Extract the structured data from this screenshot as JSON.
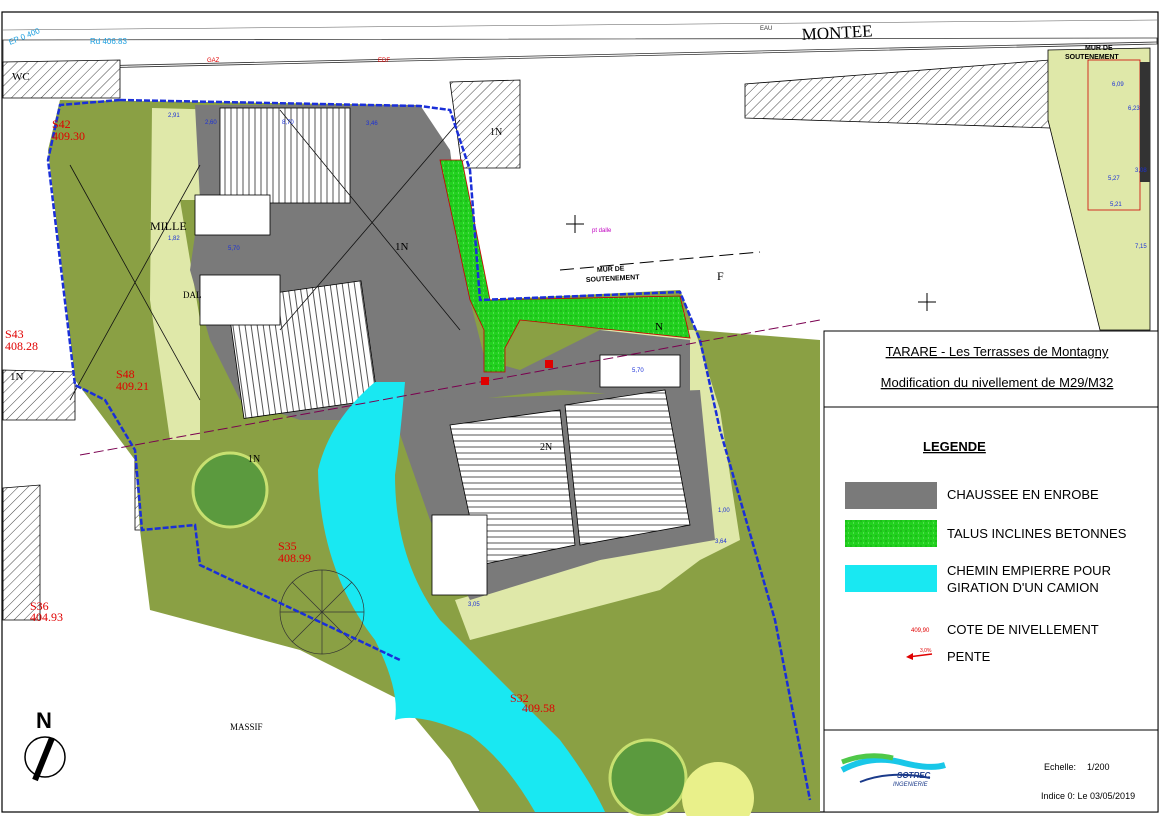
{
  "title_block": {
    "project": "TARARE - Les Terrasses de Montagny",
    "subject": "Modification du nivellement de M29/M32"
  },
  "legend": {
    "title": "LEGENDE",
    "items": [
      {
        "label": "CHAUSSEE EN ENROBE",
        "color": "#7a7a7a"
      },
      {
        "label": "TALUS INCLINES BETONNES",
        "color": "#22d11f"
      },
      {
        "label_line1": "CHEMIN EMPIERRE POUR",
        "label_line2": "GIRATION D'UN CAMION",
        "color": "#19e8f2"
      },
      {
        "sample": "409,90",
        "label": "COTE DE NIVELLEMENT",
        "color": "#e00000"
      },
      {
        "sample": "3,0%",
        "label": "PENTE",
        "color": "#e00000"
      }
    ]
  },
  "company": {
    "name": "SOTREC",
    "sub": "INGENIERIE"
  },
  "scale": {
    "label": "Echelle:",
    "value": "1/200"
  },
  "revision": "Indice 0: Le 03/05/2019",
  "north": "N",
  "colors": {
    "lawn": "#8aa044",
    "pale_green": "#dfe8a9",
    "paving": "#7a7a7a",
    "talus": "#22d11f",
    "path": "#19e8f2",
    "boundary": "#1a2fd8",
    "level": "#e00000"
  },
  "map_labels": {
    "road": "MONTEE",
    "wall": "MUR DE",
    "wall2": "SOUTENEMENT",
    "wall_right": "MUR DE",
    "wall_right2": "SOUTENEMENT",
    "mille": "MILLE",
    "massif": "MASSIF",
    "wc": "WC",
    "gaz": "GAZ",
    "edf": "EDF",
    "eau": "EAU",
    "pt_dalle": "pt dalle",
    "ep": "EP 0 400",
    "rd": "Rd 406.83",
    "dal": "DAL",
    "n1a": "1N",
    "n1b": "1N",
    "n1c": "1N",
    "n1d": "1N",
    "n2": "2N",
    "n3": "N",
    "f1": "F",
    "s42": "S42",
    "s42v": "409.30",
    "s43": "S43",
    "s43v": "408.28",
    "s48": "S48",
    "s48v": "409.21",
    "s35": "S35",
    "s35v": "408.99",
    "s36": "S36",
    "s36v": "404.93",
    "s32": "S32",
    "s32v": "409.58",
    "dim_291": "2,91",
    "dim_260": "2,60",
    "dim_870": "8,70",
    "dim_346": "3,46",
    "dim_570a": "5,70",
    "dim_570b": "5,70",
    "dim_609": "6,09",
    "dim_623": "6,23",
    "dim_527": "5,27",
    "dim_521": "5,21",
    "dim_715": "7,15",
    "dim_308": "3,08",
    "dim_364": "3,64",
    "dim_305": "3,05",
    "dim_100": "1,00",
    "dim_182": "1,82"
  }
}
